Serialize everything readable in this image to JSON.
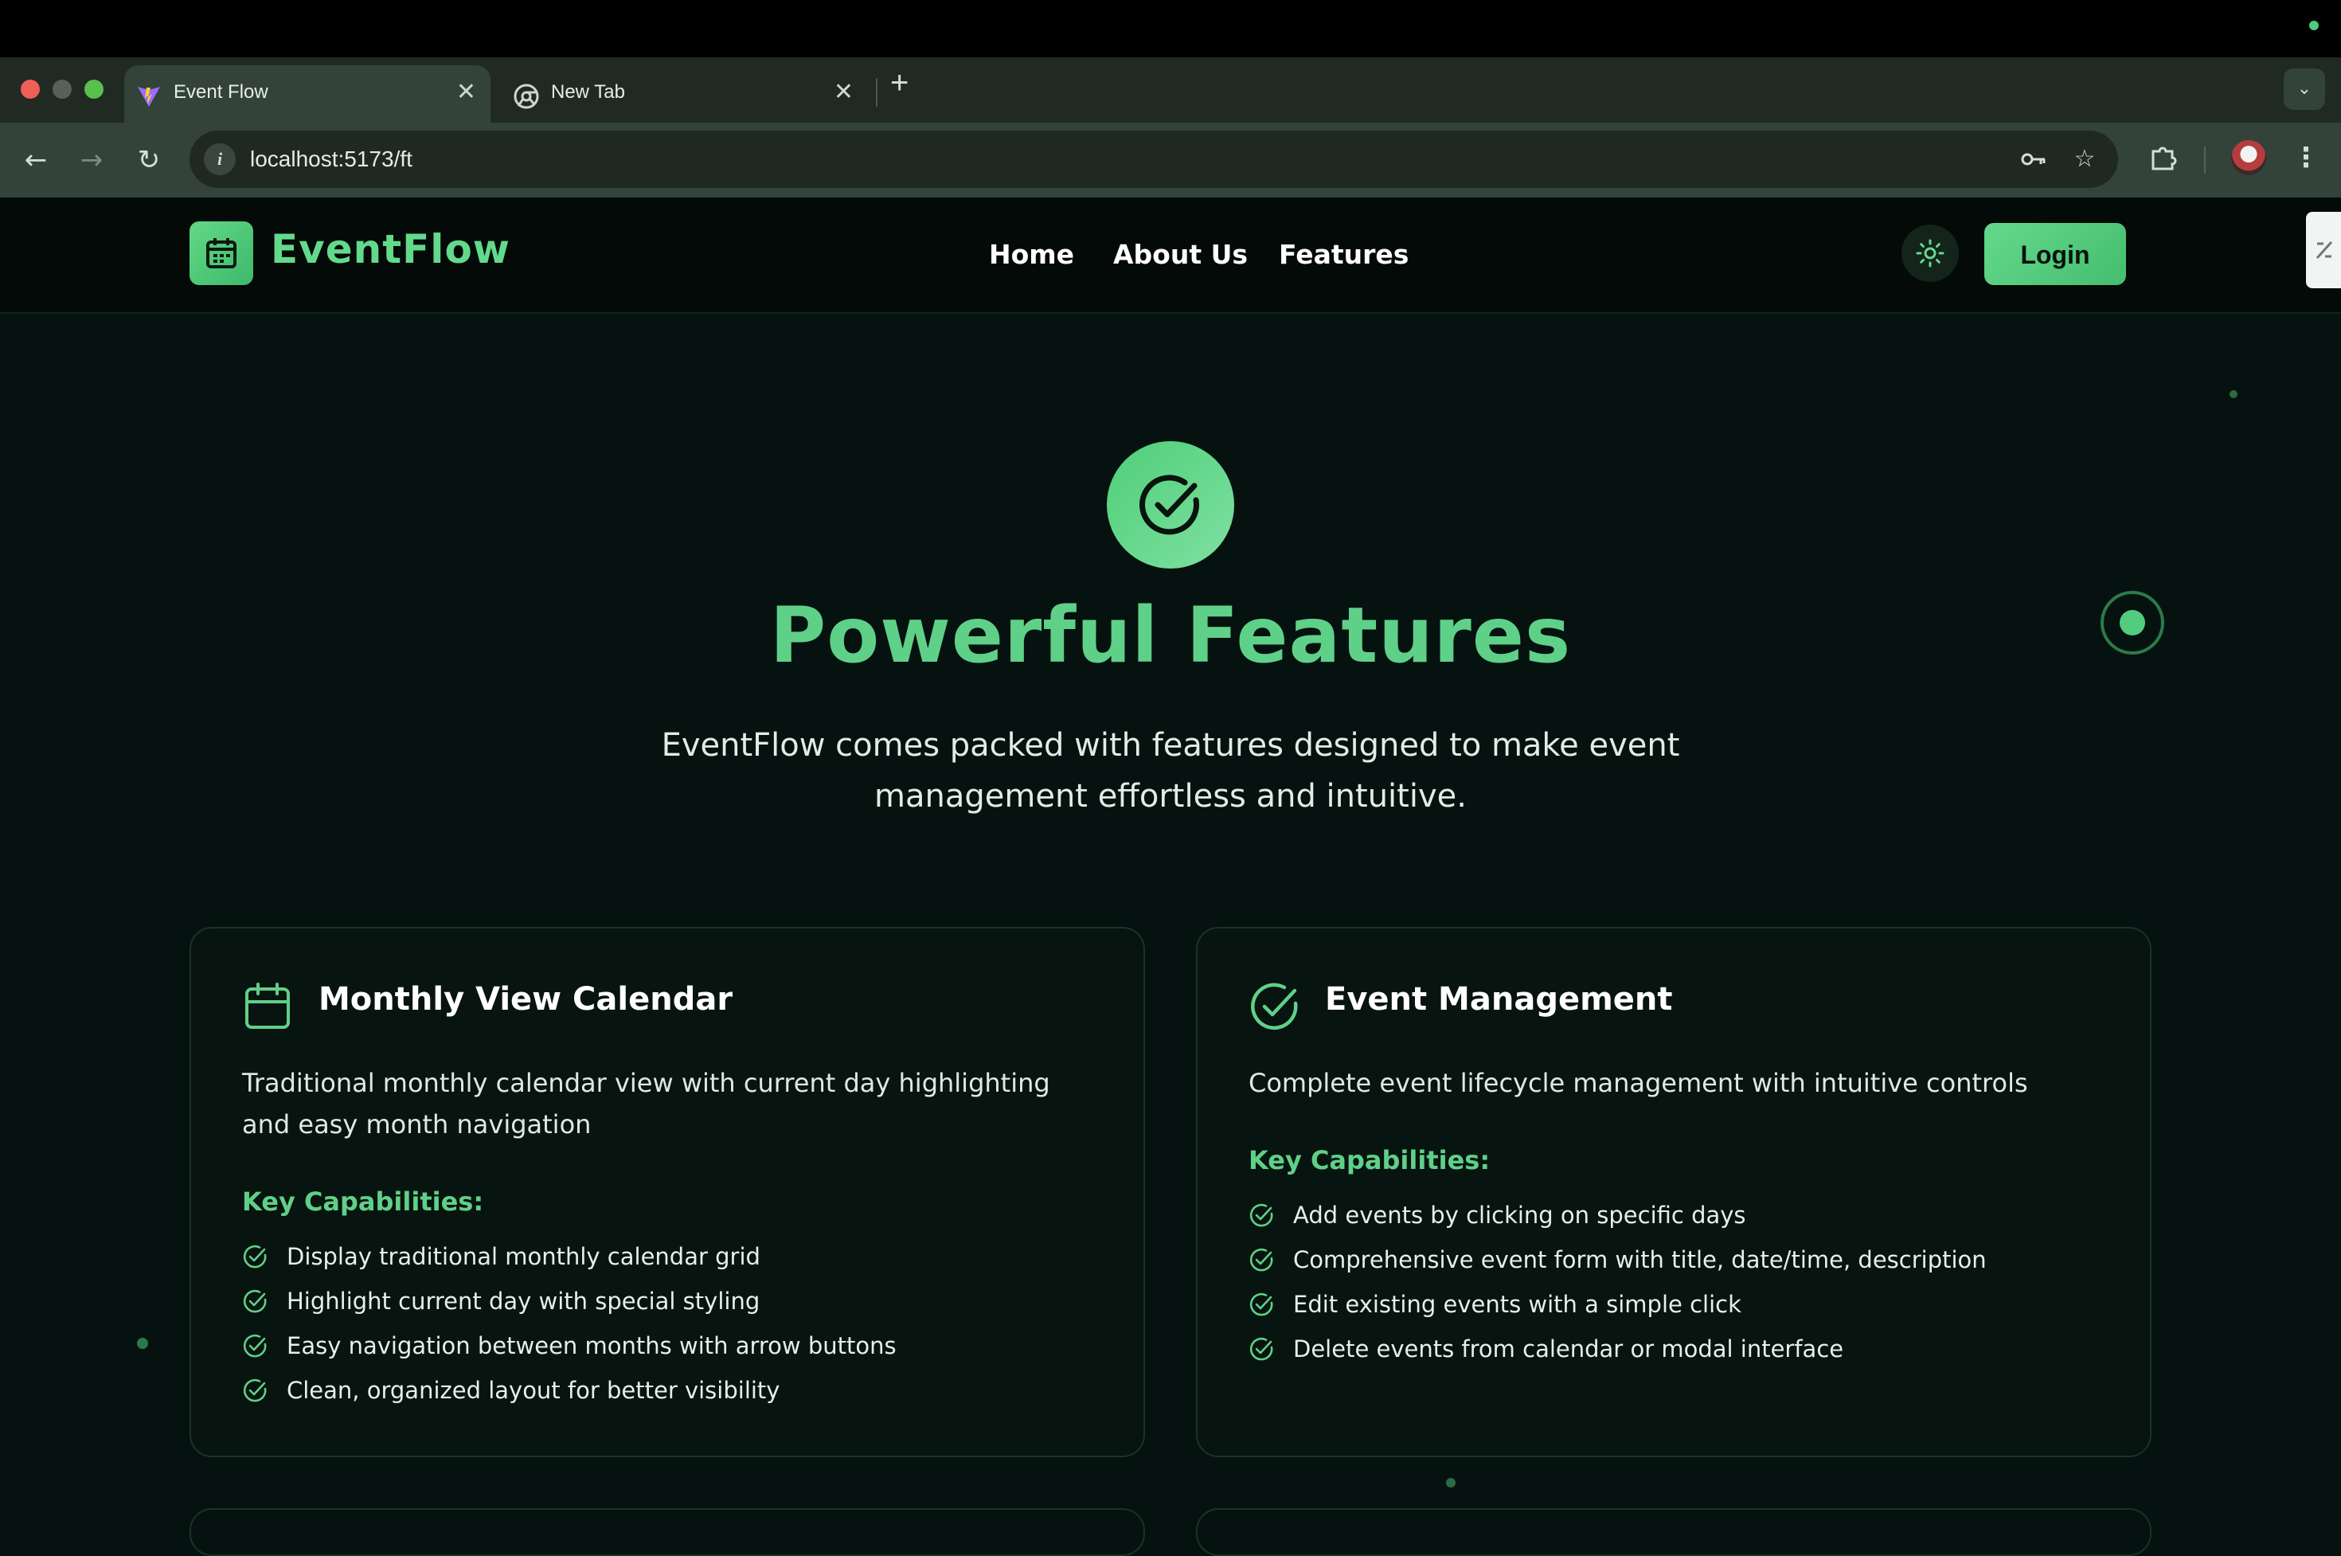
{
  "browser": {
    "tabs": [
      {
        "title": "Event Flow",
        "active": true
      },
      {
        "title": "New Tab",
        "active": false
      }
    ],
    "close_glyph": "✕",
    "new_tab_glyph": "+",
    "url": "localhost:5173/ft"
  },
  "header": {
    "brand": "EventFlow",
    "nav": [
      "Home",
      "About Us",
      "Features"
    ],
    "login_label": "Login"
  },
  "hero": {
    "title": "Powerful Features",
    "subtitle": "EventFlow comes packed with features designed to make event management effortless and intuitive."
  },
  "features": [
    {
      "icon": "calendar-icon",
      "title": "Monthly View Calendar",
      "description": "Traditional monthly calendar view with current day highlighting and easy month navigation",
      "capabilities_title": "Key Capabilities:",
      "capabilities": [
        "Display traditional monthly calendar grid",
        "Highlight current day with special styling",
        "Easy navigation between months with arrow buttons",
        "Clean, organized layout for better visibility"
      ]
    },
    {
      "icon": "check-circle-icon",
      "title": "Event Management",
      "description": "Complete event lifecycle management with intuitive controls",
      "capabilities_title": "Key Capabilities:",
      "capabilities": [
        "Add events by clicking on specific days",
        "Comprehensive event form with title, date/time, description",
        "Edit existing events with a simple click",
        "Delete events from calendar or modal interface"
      ]
    }
  ],
  "colors": {
    "accent": "#5fd088",
    "background": "#061210",
    "card_border": "#183426"
  }
}
